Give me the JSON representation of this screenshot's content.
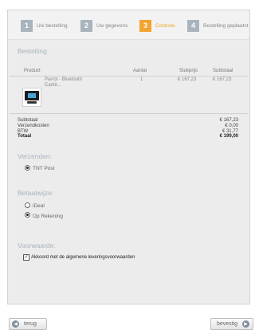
{
  "steps": [
    {
      "num": "1",
      "label": "Uw bestelling"
    },
    {
      "num": "2",
      "label": "Uw gegevens"
    },
    {
      "num": "3",
      "label": "Controle"
    },
    {
      "num": "4",
      "label": "Bestelling geplaatst"
    }
  ],
  "order": {
    "title": "Bestelling",
    "headers": {
      "product": "Product",
      "quantity": "Aantal",
      "unit_price": "Stukprijs",
      "subtotal": "Subtotaal"
    },
    "item": {
      "name_line1": "Parrot - Bluetooth",
      "name_line2": "Carkit...",
      "quantity": "1",
      "unit_price": "€ 167,23",
      "subtotal": "€ 167,23"
    }
  },
  "totals": [
    {
      "label": "Subtotaal",
      "value": "€ 167,23"
    },
    {
      "label": "Verzendkosten",
      "value": "€ 0,00"
    },
    {
      "label": "BTW",
      "value": "€ 31,77"
    },
    {
      "label": "Totaal",
      "value": "€ 199,00"
    }
  ],
  "shipping": {
    "title": "Verzenden:",
    "option": "TNT Post"
  },
  "payment": {
    "title": "Betaalwijze:",
    "options": [
      "iDeal",
      "Op Rekening"
    ]
  },
  "terms": {
    "title": "Voorwaarde:",
    "label": "Akkoord met de algemene leveringsvoorwaarden"
  },
  "buttons": {
    "back": "terug",
    "confirm": "bevestig"
  }
}
